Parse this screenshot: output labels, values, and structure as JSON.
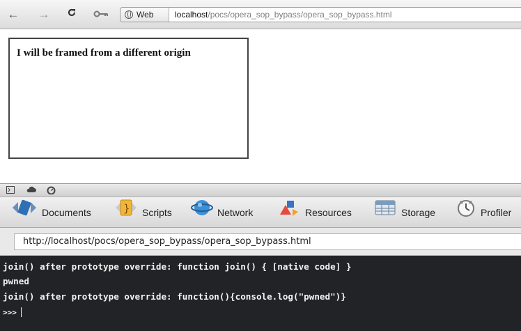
{
  "browser": {
    "address_prefix": "Web",
    "url_host": "localhost",
    "url_path": "/pocs/opera_sop_bypass/opera_sop_bypass.html"
  },
  "page": {
    "frame_text": "I will be framed from a different origin"
  },
  "inspector": {
    "tabs": [
      {
        "label": "Documents",
        "icon": "documents-icon"
      },
      {
        "label": "Scripts",
        "icon": "scripts-icon"
      },
      {
        "label": "Network",
        "icon": "network-icon"
      },
      {
        "label": "Resources",
        "icon": "resources-icon"
      },
      {
        "label": "Storage",
        "icon": "storage-icon"
      },
      {
        "label": "Profiler",
        "icon": "profiler-icon"
      }
    ],
    "source_url": "http://localhost/pocs/opera_sop_bypass/opera_sop_bypass.html"
  },
  "console": {
    "lines": [
      "join() after prototype override: function join() { [native code] }",
      "pwned",
      "join() after prototype override: function(){console.log(\"pwned\")}"
    ],
    "prompt": ">>>"
  }
}
